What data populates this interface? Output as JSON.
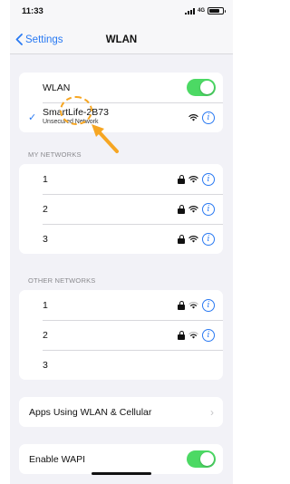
{
  "status_bar": {
    "time": "11:33",
    "network": "4G"
  },
  "nav": {
    "back_label": "Settings",
    "title": "WLAN"
  },
  "wlan_toggle": {
    "label": "WLAN",
    "enabled": true
  },
  "connected_network": {
    "name": "SmartLife-2B73",
    "subtitle": "Unsecured Network"
  },
  "my_networks": {
    "header": "MY NETWORKS",
    "items": [
      {
        "name": "1",
        "locked": true
      },
      {
        "name": "2",
        "locked": true
      },
      {
        "name": "3",
        "locked": true
      }
    ]
  },
  "other_networks": {
    "header": "OTHER NETWORKS",
    "items": [
      {
        "name": "1",
        "locked": true
      },
      {
        "name": "2",
        "locked": true
      },
      {
        "name": "3",
        "locked": false
      }
    ]
  },
  "apps_using": {
    "label": "Apps Using WLAN & Cellular"
  },
  "wapi": {
    "label": "Enable WAPI",
    "enabled": true
  },
  "colors": {
    "accent": "#2979f2",
    "toggle_on": "#4cd964",
    "annotation": "#f6a623",
    "background": "#f2f2f7"
  }
}
